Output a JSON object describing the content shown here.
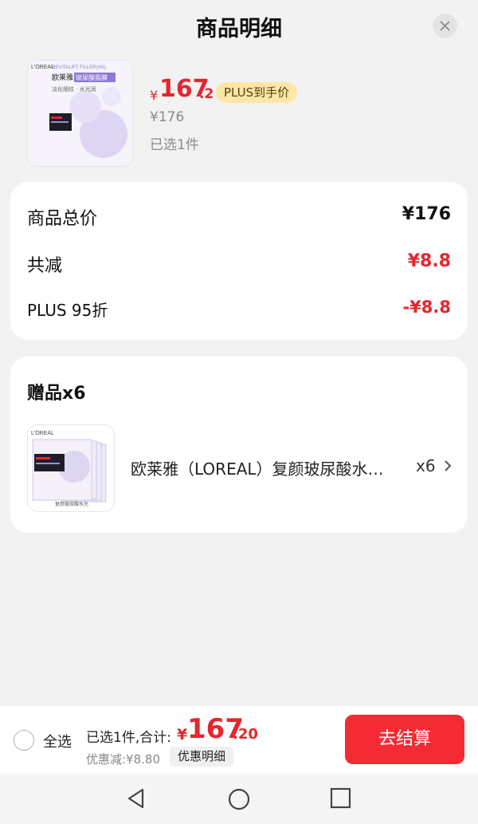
{
  "header": {
    "title": "商品明细"
  },
  "product": {
    "price_yen": "¥",
    "price_int": "167",
    "price_dec": ".2",
    "plus_badge": "PLUS到手价",
    "original_price": "¥176",
    "selected_qty": "已选1件",
    "thumb_brand": "L'OREAL",
    "thumb_line": "REVITALIFT FILLER(HA)",
    "thumb_name": "欧莱雅",
    "thumb_tag": "玻尿酸面膜",
    "thumb_sub": "淡化细纹 · 水光润"
  },
  "summary": {
    "rows": [
      {
        "label": "商品总价",
        "value": "¥176"
      },
      {
        "label": "共减",
        "value": "¥8.8"
      },
      {
        "label": "PLUS 95折",
        "value": "-¥8.8"
      }
    ]
  },
  "gifts": {
    "title": "赠品x6",
    "item": {
      "name": "欧莱雅（LOREAL）复颜玻尿酸水光充盈导入膜",
      "qty": "x6",
      "thumb_brand": "L'OREAL",
      "thumb_caption": "复颜玻尿酸水光"
    }
  },
  "bottom": {
    "select_all": "全选",
    "total_label": "已选1件,合计:",
    "total_yen": "¥",
    "total_int": "167",
    "total_dec": ".20",
    "discount": "优惠减:¥8.80",
    "detail_button": "优惠明细",
    "checkout": "去结算"
  },
  "colors": {
    "accent": "#e4262e",
    "checkout_bg": "#f42b34",
    "badge_bg": "#fde7a8"
  },
  "nav": {
    "icons": [
      "back-triangle-icon",
      "home-circle-icon",
      "recent-square-icon"
    ]
  }
}
